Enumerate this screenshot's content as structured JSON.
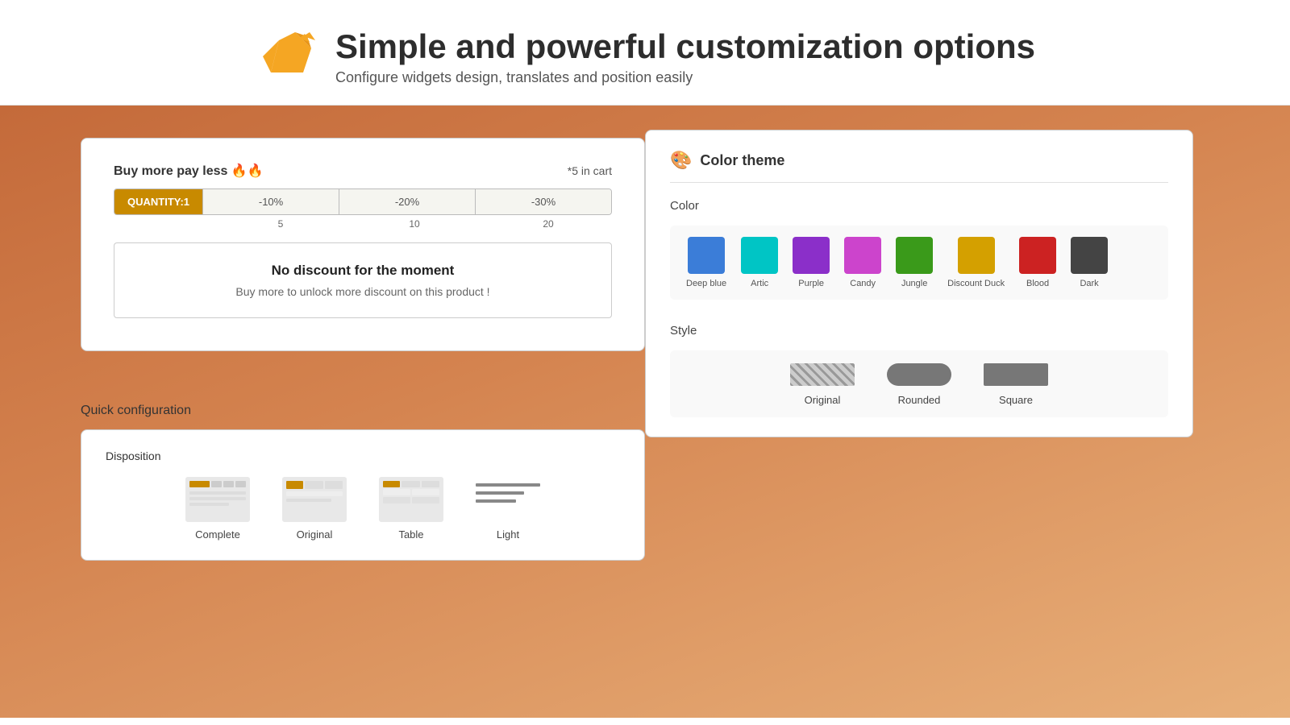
{
  "header": {
    "title": "Simple and powerful customization options",
    "subtitle": "Configure widgets design, translates and position easily"
  },
  "widget": {
    "buy_more_label": "Buy more pay less 🔥🔥",
    "cart_info": "*5 in cart",
    "quantity_label": "QUANTITY:1",
    "segments": [
      "-10%",
      "-20%",
      "-30%"
    ],
    "thresholds": [
      "5",
      "10",
      "20"
    ],
    "discount_title": "No discount for the moment",
    "discount_subtitle": "Buy more to unlock more discount on this product !"
  },
  "quick_config": {
    "title": "Quick configuration",
    "disposition_label": "Disposition",
    "options": [
      {
        "label": "Complete"
      },
      {
        "label": "Original"
      },
      {
        "label": "Table"
      },
      {
        "label": "Light"
      }
    ]
  },
  "color_theme": {
    "section_title": "Color theme",
    "color_label": "Color",
    "colors": [
      {
        "name": "Deep blue",
        "hex": "#3b7dd8"
      },
      {
        "name": "Artic",
        "hex": "#00c5c5"
      },
      {
        "name": "Purple",
        "hex": "#8b2fc9"
      },
      {
        "name": "Candy",
        "hex": "#cc44cc"
      },
      {
        "name": "Jungle",
        "hex": "#3a9a1a"
      },
      {
        "name": "Discount Duck",
        "hex": "#d4a000"
      },
      {
        "name": "Blood",
        "hex": "#cc2222"
      },
      {
        "name": "Dark",
        "hex": "#444444"
      }
    ],
    "style_label": "Style",
    "styles": [
      {
        "name": "Original"
      },
      {
        "name": "Rounded"
      },
      {
        "name": "Square"
      }
    ]
  }
}
